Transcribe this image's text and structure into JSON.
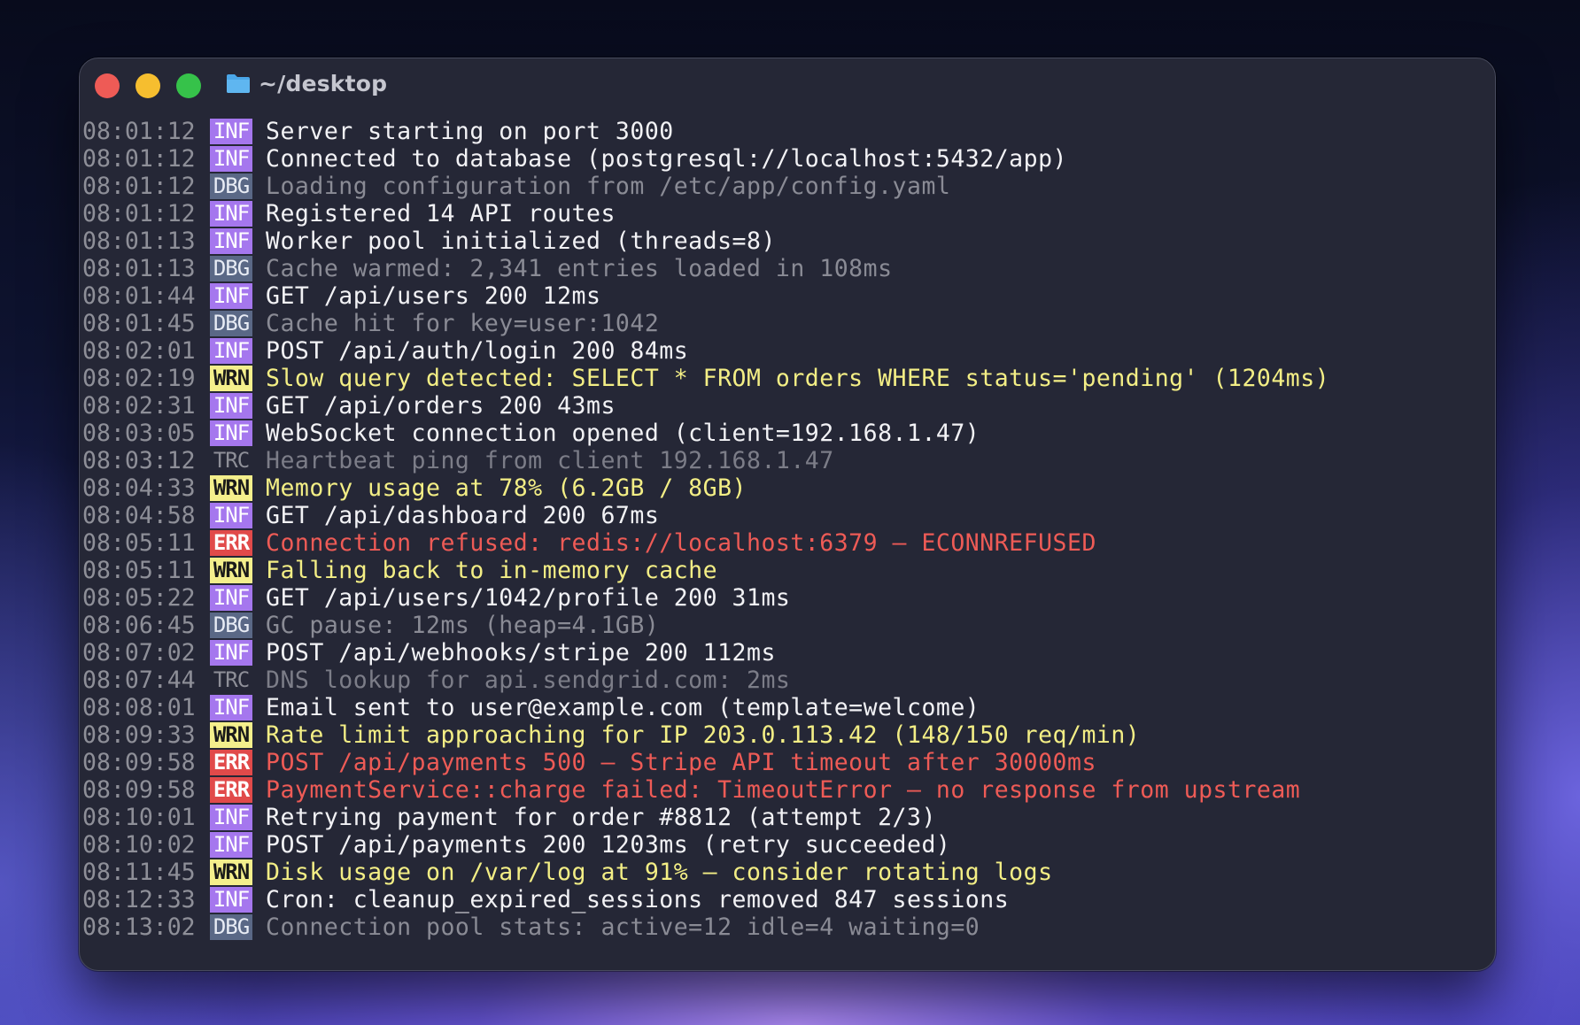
{
  "window": {
    "title": "~/desktop",
    "title_icon": "folder-icon",
    "controls": [
      "close",
      "minimize",
      "maximize"
    ]
  },
  "colors": {
    "INF": "#a577ee",
    "DBG": "#5a6886",
    "WRN": "#f4ef8c",
    "ERR": "#e14a4a",
    "TRC": "#8e8f98"
  },
  "log": [
    {
      "time": "08:01:12",
      "level": "INF",
      "message": "Server starting on port 3000"
    },
    {
      "time": "08:01:12",
      "level": "INF",
      "message": "Connected to database (postgresql://localhost:5432/app)"
    },
    {
      "time": "08:01:12",
      "level": "DBG",
      "message": "Loading configuration from /etc/app/config.yaml"
    },
    {
      "time": "08:01:12",
      "level": "INF",
      "message": "Registered 14 API routes"
    },
    {
      "time": "08:01:13",
      "level": "INF",
      "message": "Worker pool initialized (threads=8)"
    },
    {
      "time": "08:01:13",
      "level": "DBG",
      "message": "Cache warmed: 2,341 entries loaded in 108ms"
    },
    {
      "time": "08:01:44",
      "level": "INF",
      "message": "GET /api/users 200 12ms"
    },
    {
      "time": "08:01:45",
      "level": "DBG",
      "message": "Cache hit for key=user:1042"
    },
    {
      "time": "08:02:01",
      "level": "INF",
      "message": "POST /api/auth/login 200 84ms"
    },
    {
      "time": "08:02:19",
      "level": "WRN",
      "message": "Slow query detected: SELECT * FROM orders WHERE status='pending' (1204ms)"
    },
    {
      "time": "08:02:31",
      "level": "INF",
      "message": "GET /api/orders 200 43ms"
    },
    {
      "time": "08:03:05",
      "level": "INF",
      "message": "WebSocket connection opened (client=192.168.1.47)"
    },
    {
      "time": "08:03:12",
      "level": "TRC",
      "message": "Heartbeat ping from client 192.168.1.47"
    },
    {
      "time": "08:04:33",
      "level": "WRN",
      "message": "Memory usage at 78% (6.2GB / 8GB)"
    },
    {
      "time": "08:04:58",
      "level": "INF",
      "message": "GET /api/dashboard 200 67ms"
    },
    {
      "time": "08:05:11",
      "level": "ERR",
      "message": "Connection refused: redis://localhost:6379 — ECONNREFUSED"
    },
    {
      "time": "08:05:11",
      "level": "WRN",
      "message": "Falling back to in-memory cache"
    },
    {
      "time": "08:05:22",
      "level": "INF",
      "message": "GET /api/users/1042/profile 200 31ms"
    },
    {
      "time": "08:06:45",
      "level": "DBG",
      "message": "GC pause: 12ms (heap=4.1GB)"
    },
    {
      "time": "08:07:02",
      "level": "INF",
      "message": "POST /api/webhooks/stripe 200 112ms"
    },
    {
      "time": "08:07:44",
      "level": "TRC",
      "message": "DNS lookup for api.sendgrid.com: 2ms"
    },
    {
      "time": "08:08:01",
      "level": "INF",
      "message": "Email sent to user@example.com (template=welcome)"
    },
    {
      "time": "08:09:33",
      "level": "WRN",
      "message": "Rate limit approaching for IP 203.0.113.42 (148/150 req/min)"
    },
    {
      "time": "08:09:58",
      "level": "ERR",
      "message": "POST /api/payments 500 — Stripe API timeout after 30000ms"
    },
    {
      "time": "08:09:58",
      "level": "ERR",
      "message": "PaymentService::charge failed: TimeoutError — no response from upstream"
    },
    {
      "time": "08:10:01",
      "level": "INF",
      "message": "Retrying payment for order #8812 (attempt 2/3)"
    },
    {
      "time": "08:10:02",
      "level": "INF",
      "message": "POST /api/payments 200 1203ms (retry succeeded)"
    },
    {
      "time": "08:11:45",
      "level": "WRN",
      "message": "Disk usage on /var/log at 91% — consider rotating logs"
    },
    {
      "time": "08:12:33",
      "level": "INF",
      "message": "Cron: cleanup_expired_sessions removed 847 sessions"
    },
    {
      "time": "08:13:02",
      "level": "DBG",
      "message": "Connection pool stats: active=12 idle=4 waiting=0"
    }
  ]
}
